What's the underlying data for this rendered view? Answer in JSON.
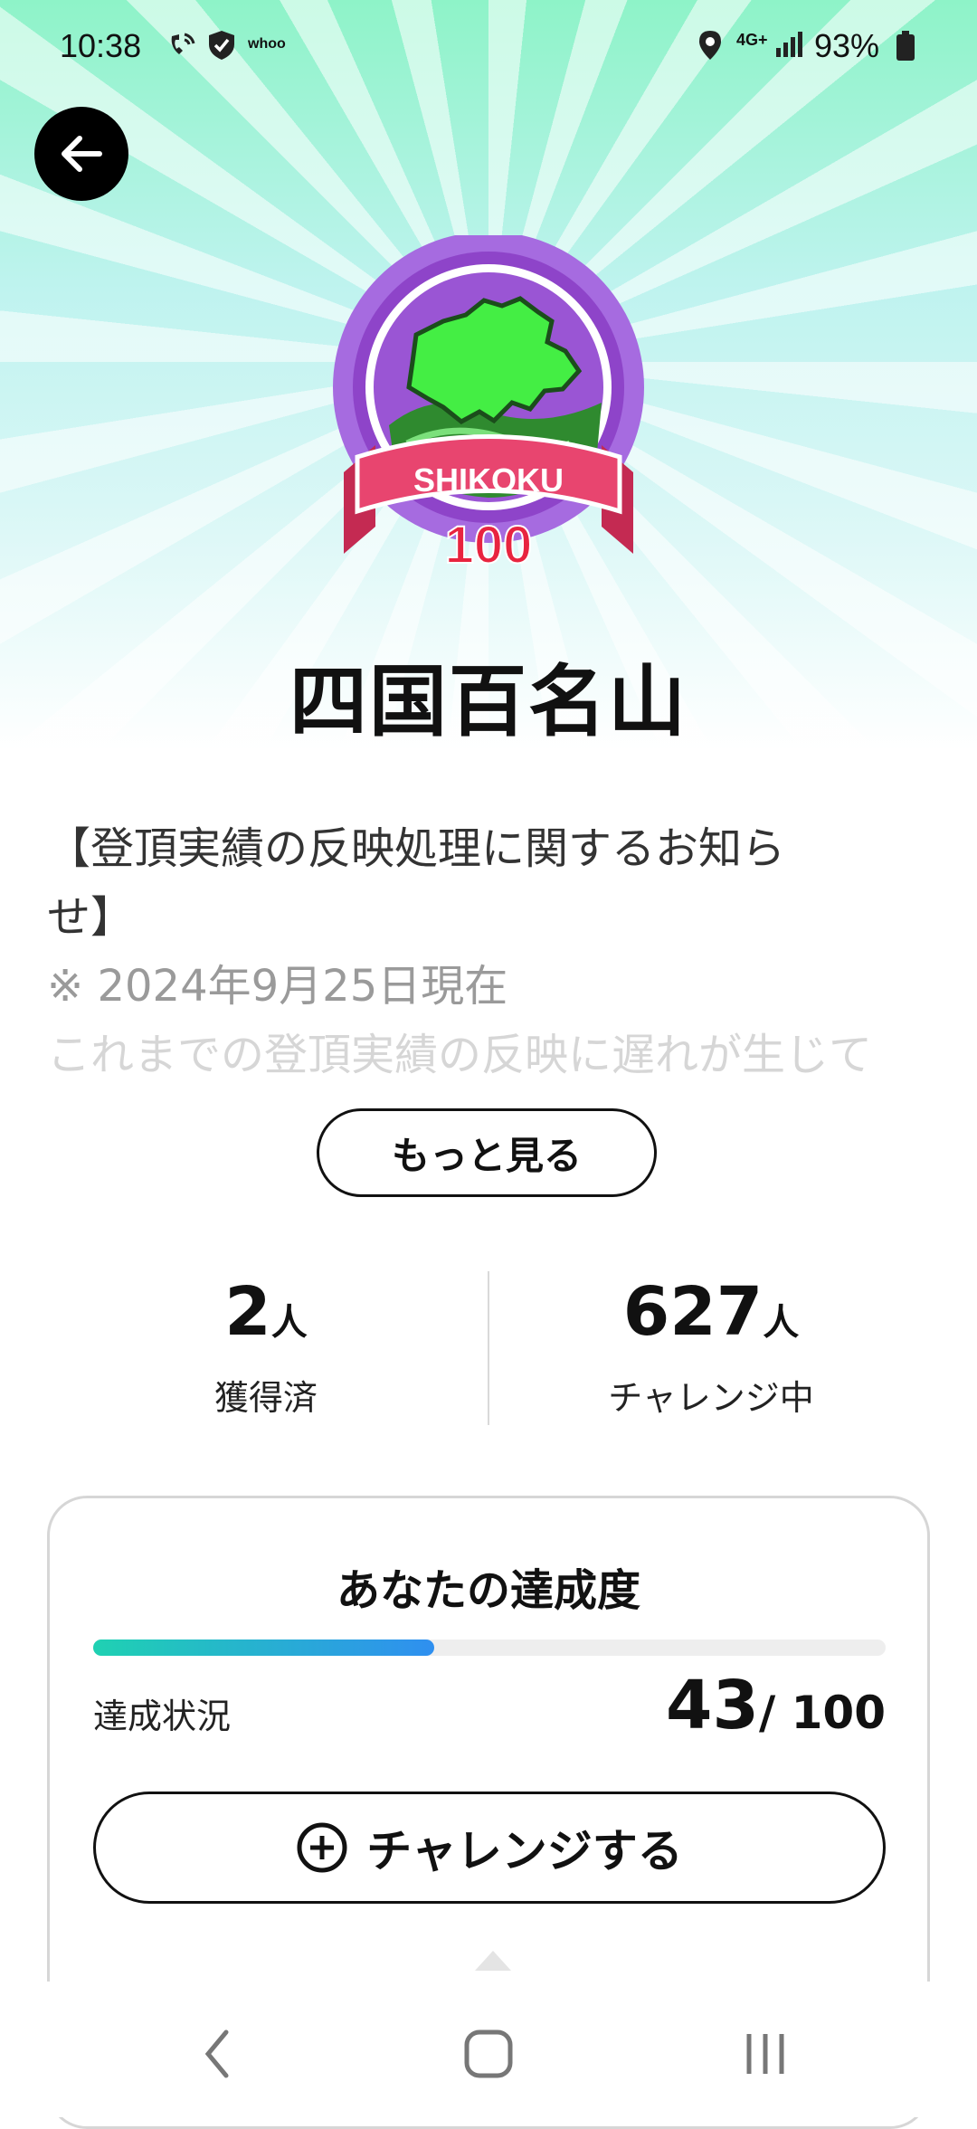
{
  "status_bar": {
    "time": "10:38",
    "app_label": "whoo",
    "network": "4G+",
    "battery": "93%"
  },
  "header": {
    "back_icon": "arrow-left-icon"
  },
  "badge": {
    "ribbon_text": "SHIKOKU",
    "number_text": "100"
  },
  "page": {
    "title": "四国百名山"
  },
  "notice": {
    "line1": "【登頂実績の反映処理に関するお知ら",
    "line2": "せ】",
    "line3": "※ 2024年9月25日現在",
    "line4": "これまでの登頂実績の反映に遅れが生じて",
    "more_label": "もっと見る"
  },
  "stats": {
    "acquired_value": "2",
    "acquired_unit": "人",
    "acquired_label": "獲得済",
    "challenging_value": "627",
    "challenging_unit": "人",
    "challenging_label": "チャレンジ中"
  },
  "progress_card": {
    "title": "あなたの達成度",
    "status_label": "達成状況",
    "achieved": "43",
    "total_text": "/ 100",
    "progress_fraction": 0.43,
    "challenge_button": "チャレンジする",
    "challenge_icon": "plus-circle-icon"
  },
  "colors": {
    "progress_start": "#1fd1b2",
    "progress_end": "#2f8ff0",
    "badge_purple": "#9b59d0",
    "ribbon_pink": "#e8456f",
    "map_green": "#3fe83a"
  },
  "nav_bar": {
    "back_icon": "chevron-left-icon",
    "home_icon": "home-rounded-square-icon",
    "recents_icon": "recents-bars-icon"
  }
}
